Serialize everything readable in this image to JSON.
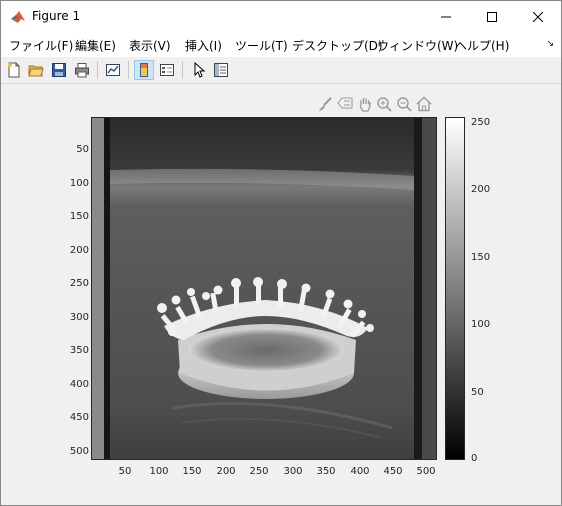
{
  "window": {
    "title": "Figure 1"
  },
  "menu": {
    "items": [
      {
        "label": "ファイル(F)"
      },
      {
        "label": "編集(E)"
      },
      {
        "label": "表示(V)"
      },
      {
        "label": "挿入(I)"
      },
      {
        "label": "ツール(T)"
      },
      {
        "label": "デスクトップ(D)"
      },
      {
        "label": "ウィンドウ(W)"
      },
      {
        "label": "ヘルプ(H)"
      }
    ]
  },
  "toolbar": {
    "icons": [
      "new-figure-icon",
      "open-file-icon",
      "save-icon",
      "print-icon",
      "link-plot-icon",
      "colorbar-toggle-icon",
      "legend-toggle-icon",
      "edit-plot-cursor-icon",
      "property-inspector-icon"
    ]
  },
  "axes_toolbar": {
    "icons": [
      "brush-icon",
      "data-tip-icon",
      "pan-hand-icon",
      "zoom-in-icon",
      "zoom-out-icon",
      "home-icon"
    ]
  },
  "image_axes": {
    "y_ticks": [
      "50",
      "100",
      "150",
      "200",
      "250",
      "300",
      "350",
      "400",
      "450",
      "500"
    ],
    "x_ticks": [
      "50",
      "100",
      "150",
      "200",
      "250",
      "300",
      "350",
      "400",
      "450",
      "500"
    ],
    "image_subject": "milk drop crown splash, grayscale"
  },
  "colorbar": {
    "ticks": [
      "250",
      "200",
      "150",
      "100",
      "50",
      "0"
    ],
    "range": [
      0,
      255
    ],
    "colormap": "gray"
  }
}
